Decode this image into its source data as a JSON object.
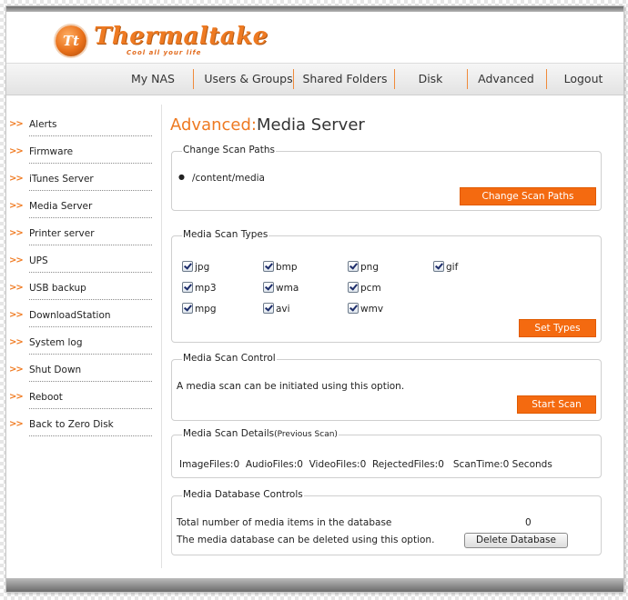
{
  "brand": {
    "name": "Thermaltake",
    "tagline": "Cool all your life",
    "logo_mark": "Tt"
  },
  "nav": [
    "My NAS",
    "Users & Groups",
    "Shared Folders",
    "Disk",
    "Advanced",
    "Logout"
  ],
  "sidebar": {
    "arrow": ">>",
    "items": [
      "Alerts",
      "Firmware",
      "iTunes Server",
      "Media Server",
      "Printer server",
      "UPS",
      "USB backup",
      "DownloadStation",
      "System log",
      "Shut Down",
      "Reboot",
      "Back to Zero Disk"
    ]
  },
  "page": {
    "title_prefix": "Advanced:",
    "title_main": "Media Server"
  },
  "scan_paths": {
    "title": "Change Scan Paths",
    "path": "/content/media",
    "button": "Change Scan Paths"
  },
  "scan_types": {
    "title": "Media Scan Types",
    "types": [
      {
        "label": "jpg",
        "checked": true
      },
      {
        "label": "bmp",
        "checked": true
      },
      {
        "label": "png",
        "checked": true
      },
      {
        "label": "gif",
        "checked": true
      },
      {
        "label": "mp3",
        "checked": true
      },
      {
        "label": "wma",
        "checked": true
      },
      {
        "label": "pcm",
        "checked": true
      },
      {
        "label": "mpg",
        "checked": true
      },
      {
        "label": "avi",
        "checked": true
      },
      {
        "label": "wmv",
        "checked": true
      }
    ],
    "button": "Set Types"
  },
  "scan_control": {
    "title": "Media Scan Control",
    "description": "A media scan can be initiated using this option.",
    "button": "Start Scan"
  },
  "scan_details": {
    "title": "Media Scan Details",
    "title_note": "(Previous Scan)",
    "line": "ImageFiles:0  AudioFiles:0  VideoFiles:0  RejectedFiles:0   ScanTime:0 Seconds"
  },
  "database": {
    "title": "Media Database Controls",
    "total_label": "Total number of media items in the database",
    "total_value": "0",
    "delete_label": "The media database can be deleted using this option.",
    "button": "Delete Database"
  },
  "colors": {
    "accent": "#ee7a22",
    "button": "#f46a10"
  }
}
